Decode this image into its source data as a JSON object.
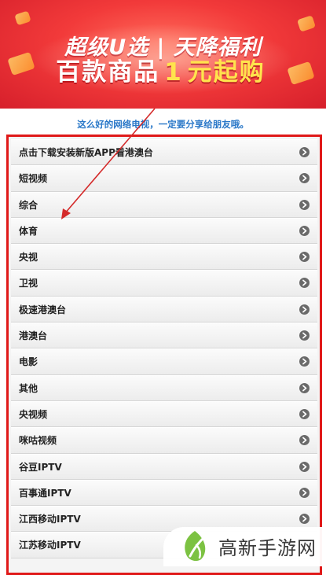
{
  "banner": {
    "line1": "超级U选 | 天降福利",
    "line2_a": "百款商品",
    "line2_b": "1",
    "line2_c": "元起购"
  },
  "notice": "这么好的网络电视，一定要分享给朋友哦。",
  "channels": [
    "点击下载安装新版APP看港澳台",
    "短视频",
    "综合",
    "体育",
    "央视",
    "卫视",
    "极速港澳台",
    "港澳台",
    "电影",
    "其他",
    "央视频",
    "咪咕视频",
    "谷豆IPTV",
    "百事通IPTV",
    "江西移动IPTV",
    "江苏移动IPTV"
  ],
  "watermark": {
    "text": "高新手游网"
  },
  "colors": {
    "frame": "#e01919",
    "notice": "#2a78c8",
    "arrow_icon": "#6a6a6a",
    "logo_green": "#7cc242"
  },
  "icons": {
    "row_arrow": "chevron-right-circle-icon",
    "watermark_logo": "leaf-logo-icon"
  }
}
